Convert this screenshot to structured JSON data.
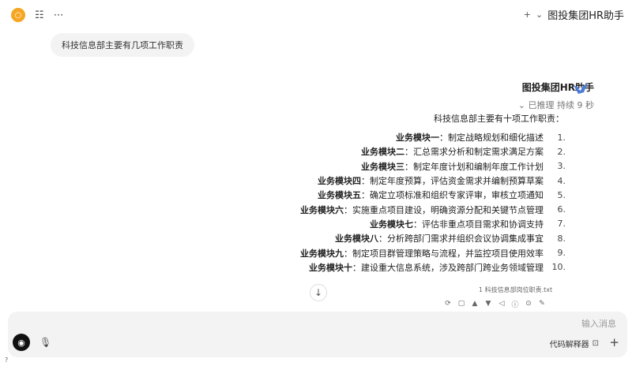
{
  "header": {
    "title": "图投集团HR助手",
    "left_buttons": [
      "settings",
      "more"
    ],
    "right_buttons": [
      "chevron-down",
      "add"
    ]
  },
  "icons": {
    "app_logo": "orange-circle-icon",
    "settings": "sliders-icon",
    "more": "ellipsis-icon",
    "avatar": "bird-logo-icon",
    "scroll_down": "arrow-down-icon",
    "mic": "microphone-icon",
    "headset": "headset-icon",
    "plus": "plus-icon",
    "code": "code-icon"
  },
  "colors": {
    "accent": "#f5a623",
    "bubble": "#f3f3f3",
    "input_bg": "#f3f3f3",
    "avatar": "#4a7bd6"
  },
  "user_message": "科技信息部主要有几项工作职责",
  "assistant": {
    "name": "图投集团HR助手",
    "status": "已推理 持续 9 秒",
    "intro": "科技信息部主要有十项工作职责：",
    "items": [
      {
        "num": "1.",
        "title": "业务模块一",
        "text": "：制定战略规划和细化描述"
      },
      {
        "num": "2.",
        "title": "业务模块二",
        "text": "：汇总需求分析和制定需求满足方案"
      },
      {
        "num": "3.",
        "title": "业务模块三",
        "text": "：制定年度计划和编制年度工作计划"
      },
      {
        "num": "4.",
        "title": "业务模块四",
        "text": "：制定年度预算，评估资金需求并编制预算草案"
      },
      {
        "num": "5.",
        "title": "业务模块五",
        "text": "：确定立项标准和组织专家评审，审核立项通知"
      },
      {
        "num": "6.",
        "title": "业务模块六",
        "text": "：实施重点项目建设，明确资源分配和关键节点管理"
      },
      {
        "num": "7.",
        "title": "业务模块七",
        "text": "：评估非重点项目需求和协调支持"
      },
      {
        "num": "8.",
        "title": "业务模块八",
        "text": "：分析跨部门需求并组织会议协调集成事宜"
      },
      {
        "num": "9.",
        "title": "业务模块九",
        "text": "：制定项目群管理策略与流程，并监控项目使用效率"
      },
      {
        "num": "10.",
        "title": "业务模块十",
        "text": "：建设重大信息系统，涉及跨部门跨业务领域管理"
      }
    ],
    "file_ref": "1 科技信息部岗位职责.txt"
  },
  "input": {
    "placeholder": "输入消息",
    "tool_label": "代码解释器"
  }
}
